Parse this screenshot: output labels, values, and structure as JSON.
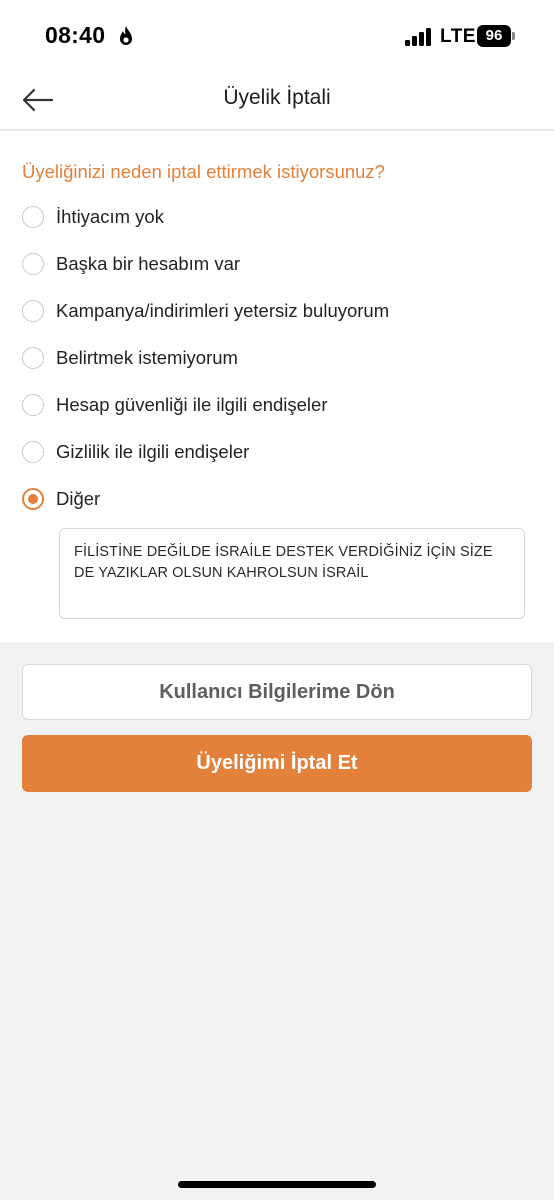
{
  "status_bar": {
    "time": "08:40",
    "time_icon": "flame-icon",
    "network": "LTE",
    "battery": "96"
  },
  "nav": {
    "back_icon": "arrow-left-icon",
    "title": "Üyelik İptali"
  },
  "form": {
    "question": "Üyeliğinizi neden iptal ettirmek istiyorsunuz?",
    "options": [
      {
        "label": "İhtiyacım yok",
        "selected": false
      },
      {
        "label": "Başka bir hesabım var",
        "selected": false
      },
      {
        "label": "Kampanya/indirimleri yetersiz buluyorum",
        "selected": false
      },
      {
        "label": "Belirtmek istemiyorum",
        "selected": false
      },
      {
        "label": "Hesap güvenliği ile ilgili endişeler",
        "selected": false
      },
      {
        "label": "Gizlilik ile ilgili endişeler",
        "selected": false
      },
      {
        "label": "Diğer",
        "selected": true
      }
    ],
    "other_text": "FİLİSTİNE DEĞİLDE İSRAİLE DESTEK VERDİĞİNİZ İÇİN SİZE DE YAZIKLAR OLSUN KAHROLSUN İSRAİL"
  },
  "buttons": {
    "back_to_profile": "Kullanıcı Bilgilerime Dön",
    "cancel_membership": "Üyeliğimi İptal Et"
  },
  "colors": {
    "accent": "#e3813a",
    "background": "#f2f2f2"
  }
}
